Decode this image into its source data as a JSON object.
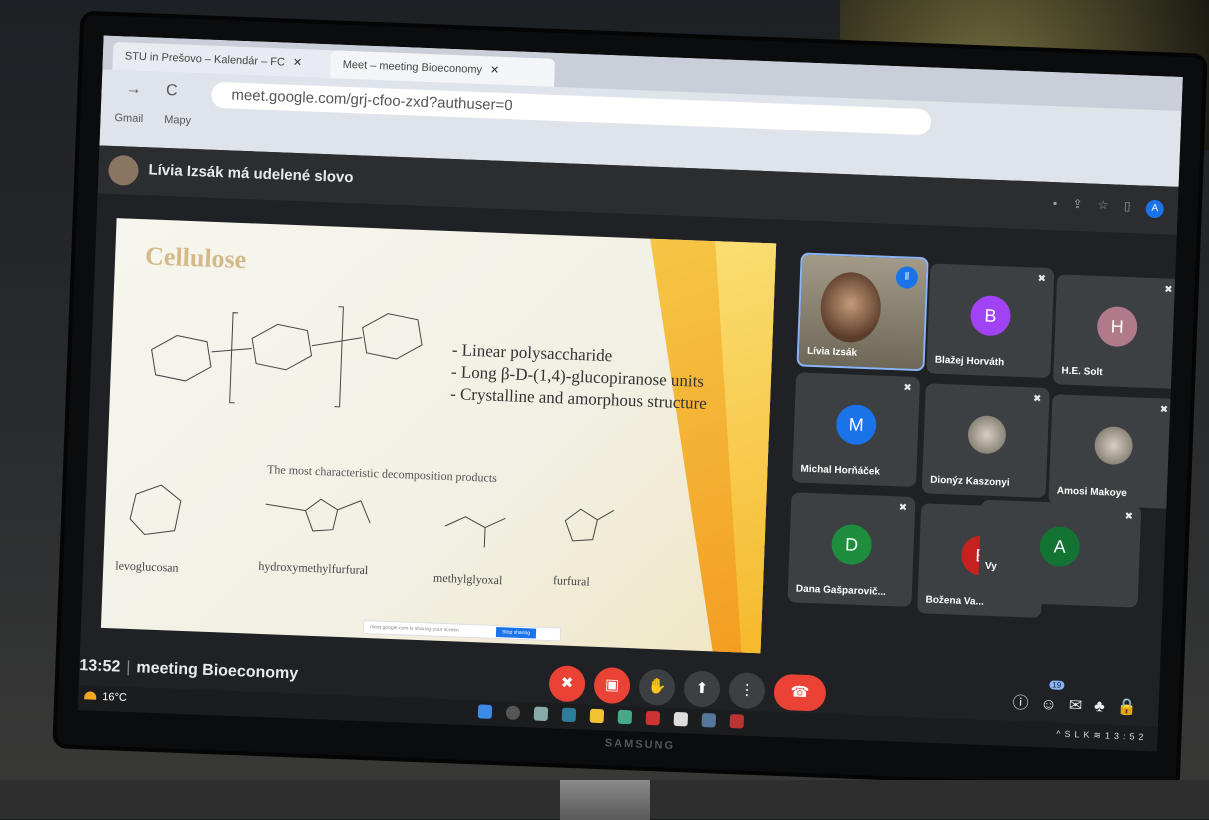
{
  "browser": {
    "tabs": [
      {
        "title": "STU in Prešovo – Kalendár – FC"
      },
      {
        "title": "Meet – meeting Bioeconomy"
      }
    ],
    "url": "meet.google.com/grj-cfoo-zxd?authuser=0",
    "bookmarks": [
      "Gmail",
      "Mapy"
    ],
    "profile_initial": "A"
  },
  "meet": {
    "speaking_banner": "Lívia Izsák má udelené slovo",
    "meeting_name": "meeting Bioeconomy",
    "time": "13:52",
    "participant_count": "19",
    "participants": [
      {
        "name": "Lívia Izsák",
        "initial": "",
        "color": "",
        "active": true
      },
      {
        "name": "Blažej Horváth",
        "initial": "B",
        "color": "#a142f4"
      },
      {
        "name": "H.E. Solt",
        "initial": "H",
        "color": "#b07a8a"
      },
      {
        "name": "Michal Horňáček",
        "initial": "M",
        "color": "#1a73e8"
      },
      {
        "name": "Dionýz Kaszonyi",
        "initial": "",
        "color": ""
      },
      {
        "name": "Amosi Makoye",
        "initial": "",
        "color": ""
      },
      {
        "name": "Dana Gašparovič...",
        "initial": "D",
        "color": "#1e8e3e"
      },
      {
        "name": "Božena Va...",
        "initial": "E",
        "color": "#c5221f"
      }
    ],
    "self": {
      "label": "Vy",
      "initial": "A",
      "color": "#137333"
    }
  },
  "slide": {
    "title": "Cellulose",
    "bullets": [
      "- Linear polysaccharide",
      "- Long β-D-(1,4)-glucopiranose units",
      "- Crystalline and amorphous structure"
    ],
    "subtitle": "The most characteristic decomposition products",
    "products": [
      "levoglucosan",
      "hydroxymethylfurfural",
      "methylglyoxal",
      "furfural"
    ],
    "share_notice": "meet.google.com is sharing your screen",
    "stop_sharing": "Stop sharing",
    "hide": "Hide"
  },
  "taskbar": {
    "temperature": "16°C",
    "language": "SLK",
    "clock": "13:52"
  },
  "monitor_brand": "SAMSUNG"
}
